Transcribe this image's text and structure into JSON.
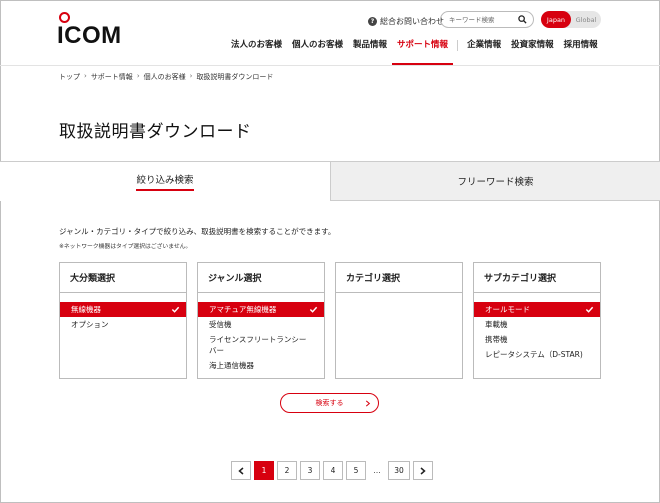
{
  "brand": {
    "logo_text": "ICOM"
  },
  "utility": {
    "inquiry_label": "総合お問い合わせ",
    "search_placeholder": "キーワード検索",
    "lang_japan": "Japan",
    "lang_global": "Global"
  },
  "gnav": {
    "items": [
      "法人のお客様",
      "個人のお客様",
      "製品情報",
      "サポート情報",
      "企業情報",
      "投資家情報",
      "採用情報"
    ],
    "active_index": 3
  },
  "breadcrumb": [
    "トップ",
    "サポート情報",
    "個人のお客様",
    "取扱説明書ダウンロード"
  ],
  "page_title": "取扱説明書ダウンロード",
  "tabs": {
    "narrow": "絞り込み検索",
    "freeword": "フリーワード検索"
  },
  "description": "ジャンル・カテゴリ・タイプで絞り込み、取扱説明書を検索することができます。",
  "note": "※ネットワーク機器はタイプ選択はございません。",
  "panels": {
    "major": {
      "title": "大分類選択",
      "options": [
        "無線機器",
        "オプション"
      ],
      "selected": 0
    },
    "genre": {
      "title": "ジャンル選択",
      "options": [
        "アマチュア無線機器",
        "受信機",
        "ライセンスフリートランシーバー",
        "海上通信機器"
      ],
      "selected": 0
    },
    "category": {
      "title": "カテゴリ選択",
      "options": []
    },
    "subcategory": {
      "title": "サブカテゴリ選択",
      "options": [
        "オールモード",
        "車載機",
        "携帯機",
        "レピータシステム（D-STAR)"
      ],
      "selected": 0
    }
  },
  "search_button": "検索する",
  "pagination": {
    "pages": [
      "1",
      "2",
      "3",
      "4",
      "5"
    ],
    "ellipsis": "...",
    "last": "30",
    "current": "1"
  },
  "colors": {
    "accent": "#d7000f"
  }
}
